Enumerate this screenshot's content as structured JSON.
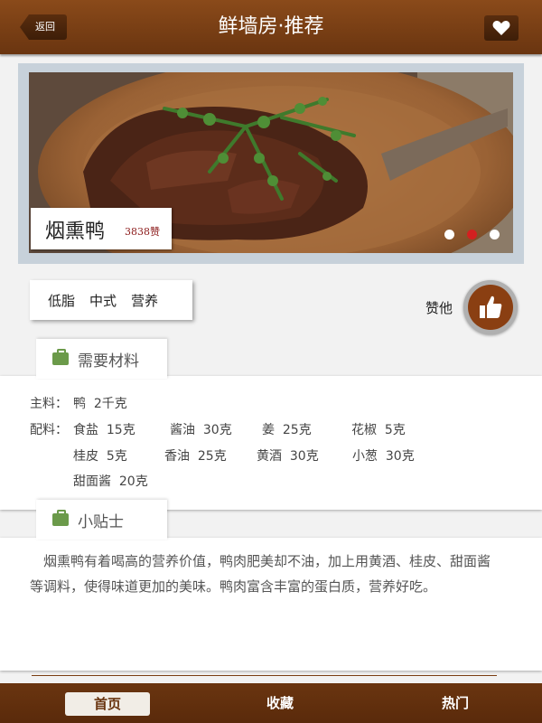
{
  "header": {
    "back_label": "返回",
    "title": "鲜墙房·推荐",
    "favorite_icon": "heart-icon"
  },
  "hero": {
    "dish_name": "烟熏鸭",
    "like_count": "3838赞",
    "slides_total": 3,
    "slide_active": 2
  },
  "tags": [
    "低脂",
    "中式",
    "营养"
  ],
  "like_label": "赞他",
  "like_icon": "thumbs-up-icon",
  "materials": {
    "title": "需要材料",
    "main_label": "主料：",
    "main_items": "鸭  2千克",
    "seasoning_label": "配料：",
    "rows": [
      [
        "食盐  15克",
        "酱油  30克",
        "姜  25克",
        "花椒  5克"
      ],
      [
        "桂皮  5克",
        "香油  25克",
        "黄酒  30克",
        "小葱  30克"
      ],
      [
        "甜面酱  20克"
      ]
    ]
  },
  "tips": {
    "title": "小贴士",
    "text": "烟熏鸭有着喝高的营养价值，鸭肉肥美却不油，加上用黄酒、桂皮、甜面酱等调料，使得味道更加的美味。鸭肉富含丰富的蛋白质，营养好吃。"
  },
  "nav": [
    {
      "label": "首页",
      "active": true
    },
    {
      "label": "收藏",
      "active": false
    },
    {
      "label": "热门",
      "active": false
    }
  ],
  "colors": {
    "brand_brown": "#7a3d12",
    "active_dot": "#d42020",
    "tab_icon_green": "#6b9a4a"
  }
}
